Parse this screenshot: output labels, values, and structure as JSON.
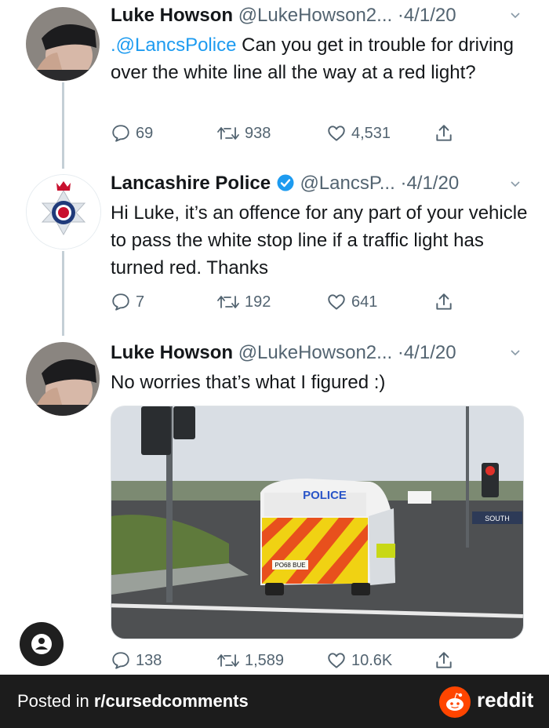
{
  "tweets": [
    {
      "name": "Luke Howson",
      "handle": "@LukeHowson2...",
      "dot": "·",
      "date": "4/1/20",
      "mention": ".@LancsPolice",
      "text": " Can you get in trouble for driving over the white line all the way at a red light?",
      "replies": "69",
      "retweets": "938",
      "likes": "4,531"
    },
    {
      "name": "Lancashire Police",
      "handle": "@LancsP...",
      "dot": "·",
      "date": "4/1/20",
      "text": "Hi Luke, it’s an offence for any part of your vehicle to pass the white stop line if a traffic light has turned red. Thanks",
      "replies": "7",
      "retweets": "192",
      "likes": "641"
    },
    {
      "name": "Luke Howson",
      "handle": "@LukeHowson2...",
      "dot": "·",
      "date": "4/1/20",
      "text": "No worries that’s what I figured :)",
      "replies": "138",
      "retweets": "1,589",
      "likes": "10.6K"
    }
  ],
  "photo": {
    "van_label": "POLICE",
    "plate": "PO68 BUE",
    "sign_text": "SOUTH"
  },
  "footer": {
    "posted_prefix": "Posted in ",
    "subreddit": "r/cursedcomments",
    "brand": "reddit"
  },
  "colors": {
    "accent_blue": "#1d9bf0",
    "muted": "#536471",
    "footer_bg": "#1c1c1c",
    "reddit_orange": "#ff4500"
  }
}
